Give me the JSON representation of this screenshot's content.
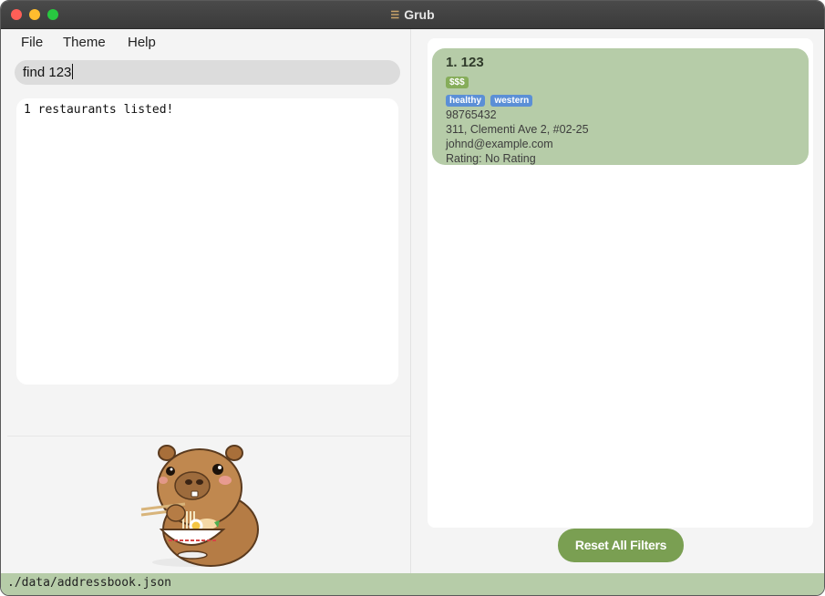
{
  "window": {
    "title": "Grub",
    "title_icon": "burger-icon"
  },
  "menu": {
    "file": "File",
    "theme": "Theme",
    "help": "Help"
  },
  "command_box": {
    "value": "find 123"
  },
  "result_display": {
    "text": "1 restaurants listed!"
  },
  "restaurant_list": [
    {
      "title": "1. 123",
      "price": "$$$",
      "tags": [
        "healthy",
        "western"
      ],
      "phone": "98765432",
      "address": "311, Clementi Ave 2, #02-25",
      "email": "johnd@example.com",
      "rating": "Rating: No Rating"
    }
  ],
  "reset_button": {
    "label": "Reset All Filters"
  },
  "status_bar": {
    "path": "./data/addressbook.json"
  },
  "colors": {
    "card_bg": "#b6cca8",
    "price_badge": "#86ad5a",
    "tag_badge": "#5b8fd6",
    "reset_button": "#7a9f52",
    "status_bar": "#b6cca8"
  }
}
